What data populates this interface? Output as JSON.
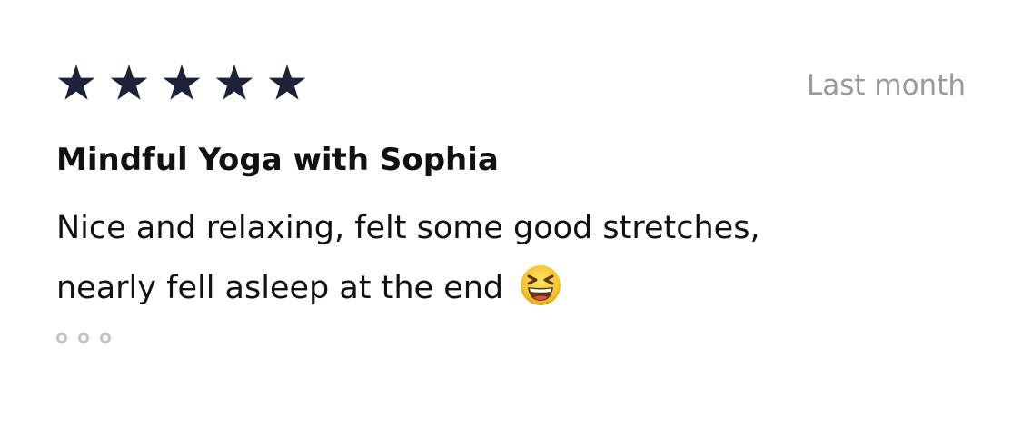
{
  "review": {
    "rating": 5,
    "rating_max": 5,
    "star_color": "#1c2237",
    "date": "Last month",
    "title": "Mindful Yoga with Sophia",
    "body_line1": "Nice and relaxing, felt some good stretches,",
    "body_line2": "nearly fell asleep at the end",
    "emoji": "grinning-squinting-face",
    "more_icon": "ellipsis-dots"
  }
}
